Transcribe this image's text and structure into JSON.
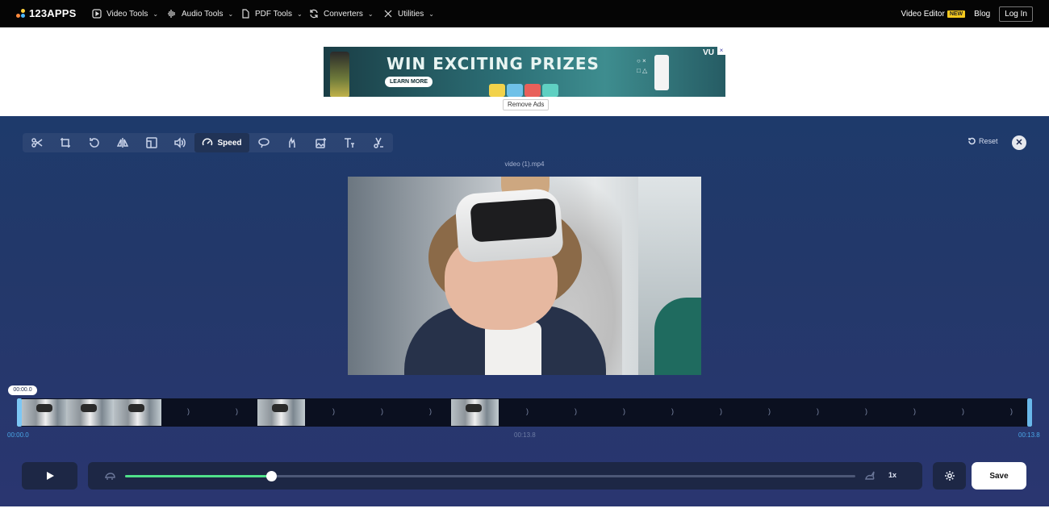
{
  "nav": {
    "logo": "123APPS",
    "items": [
      {
        "label": "Video Tools",
        "icon": "play-square-icon"
      },
      {
        "label": "Audio Tools",
        "icon": "waveform-icon"
      },
      {
        "label": "PDF Tools",
        "icon": "document-icon"
      },
      {
        "label": "Converters",
        "icon": "convert-icon"
      },
      {
        "label": "Utilities",
        "icon": "tools-icon"
      }
    ],
    "video_editor": "Video Editor",
    "new_badge": "NEW",
    "blog": "Blog",
    "login": "Log In"
  },
  "ad": {
    "headline": "WIN EXCITING PRIZES",
    "cta": "LEARN MORE",
    "brand": "VU",
    "remove_ads": "Remove Ads"
  },
  "editor": {
    "tools": [
      {
        "name": "cut",
        "icon": "scissors-icon"
      },
      {
        "name": "crop",
        "icon": "crop-icon"
      },
      {
        "name": "rotate",
        "icon": "rotate-icon"
      },
      {
        "name": "flip",
        "icon": "flip-icon"
      },
      {
        "name": "resize",
        "icon": "resize-icon"
      },
      {
        "name": "volume",
        "icon": "volume-icon"
      },
      {
        "name": "speed",
        "icon": "speedometer-icon",
        "label": "Speed",
        "active": true
      },
      {
        "name": "loop",
        "icon": "loop-icon"
      },
      {
        "name": "stabilize",
        "icon": "stabilize-icon"
      },
      {
        "name": "image",
        "icon": "add-image-icon"
      },
      {
        "name": "text",
        "icon": "text-icon"
      },
      {
        "name": "remove-logo",
        "icon": "eraser-icon"
      }
    ],
    "reset": "Reset",
    "close": "✕",
    "filename": "video (1).mp4"
  },
  "timeline": {
    "current_bubble": "00:00.0",
    "start": "00:00.0",
    "middle": "00:13.8",
    "end": "00:13.8",
    "speed_marker": ")"
  },
  "controls": {
    "speed_value": "1x",
    "speed_fraction": 0.2,
    "save": "Save"
  },
  "colors": {
    "accent_green": "#4fe08a",
    "handle_blue": "#7cc7f5",
    "editor_bg": "#1e3a6b",
    "new_badge": "#f4c81e"
  }
}
